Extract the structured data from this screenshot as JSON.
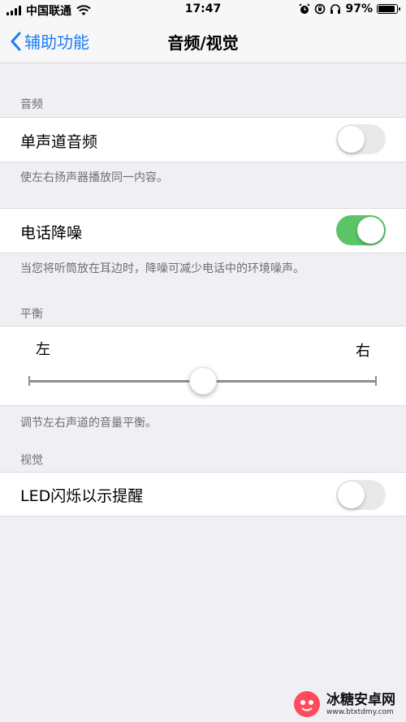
{
  "status_bar": {
    "carrier": "中国联通",
    "time": "17:47",
    "battery_percent": "97%",
    "battery_level": 0.97,
    "icons": [
      "signal-icon",
      "wifi-icon",
      "alarm-icon",
      "orientation-lock-icon",
      "headphones-icon",
      "battery-icon"
    ]
  },
  "nav": {
    "back_label": "辅助功能",
    "title": "音频/视觉"
  },
  "sections": {
    "audio_header": "音频",
    "mono_audio_label": "单声道音频",
    "mono_audio_on": false,
    "mono_footer": "使左右扬声器播放同一内容。",
    "noise_cancel_label": "电话降噪",
    "noise_cancel_on": true,
    "noise_footer": "当您将听筒放在耳边时，降噪可减少电话中的环境噪声。",
    "balance_header": "平衡",
    "balance_left": "左",
    "balance_right": "右",
    "balance_value": 0.5,
    "balance_footer": "调节左右声道的音量平衡。",
    "visual_header": "视觉",
    "led_flash_label": "LED闪烁以示提醒",
    "led_flash_on": false
  },
  "watermark": {
    "title": "冰糖安卓网",
    "url": "www.btxtdmy.com"
  },
  "colors": {
    "ios_blue": "#1a7df6",
    "toggle_on": "#5ac466",
    "toggle_off": "#e9e9ea",
    "background": "#efeff4"
  }
}
